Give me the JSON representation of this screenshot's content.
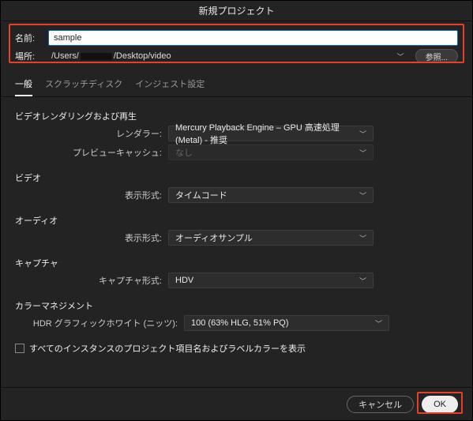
{
  "title": "新規プロジェクト",
  "top": {
    "name_label": "名前:",
    "name_value": "sample",
    "location_label": "場所:",
    "location_prefix": "/Users/",
    "location_suffix": "/Desktop/video",
    "browse": "参照..."
  },
  "tabs": {
    "general": "一般",
    "scratch": "スクラッチディスク",
    "ingest": "インジェスト設定"
  },
  "render": {
    "section": "ビデオレンダリングおよび再生",
    "renderer_label": "レンダラー:",
    "renderer_value": "Mercury Playback Engine – GPU 高速処理 (Metal) - 推奨",
    "preview_label": "プレビューキャッシュ:",
    "preview_value": "なし"
  },
  "video": {
    "section": "ビデオ",
    "format_label": "表示形式:",
    "format_value": "タイムコード"
  },
  "audio": {
    "section": "オーディオ",
    "format_label": "表示形式:",
    "format_value": "オーディオサンプル"
  },
  "capture": {
    "section": "キャプチャ",
    "format_label": "キャプチャ形式:",
    "format_value": "HDV"
  },
  "color": {
    "section": "カラーマネジメント",
    "hdr_label": "HDR グラフィックホワイト (ニッツ):",
    "hdr_value": "100 (63% HLG, 51% PQ)"
  },
  "checkbox_label": "すべてのインスタンスのプロジェクト項目名およびラベルカラーを表示",
  "footer": {
    "cancel": "キャンセル",
    "ok": "OK"
  }
}
